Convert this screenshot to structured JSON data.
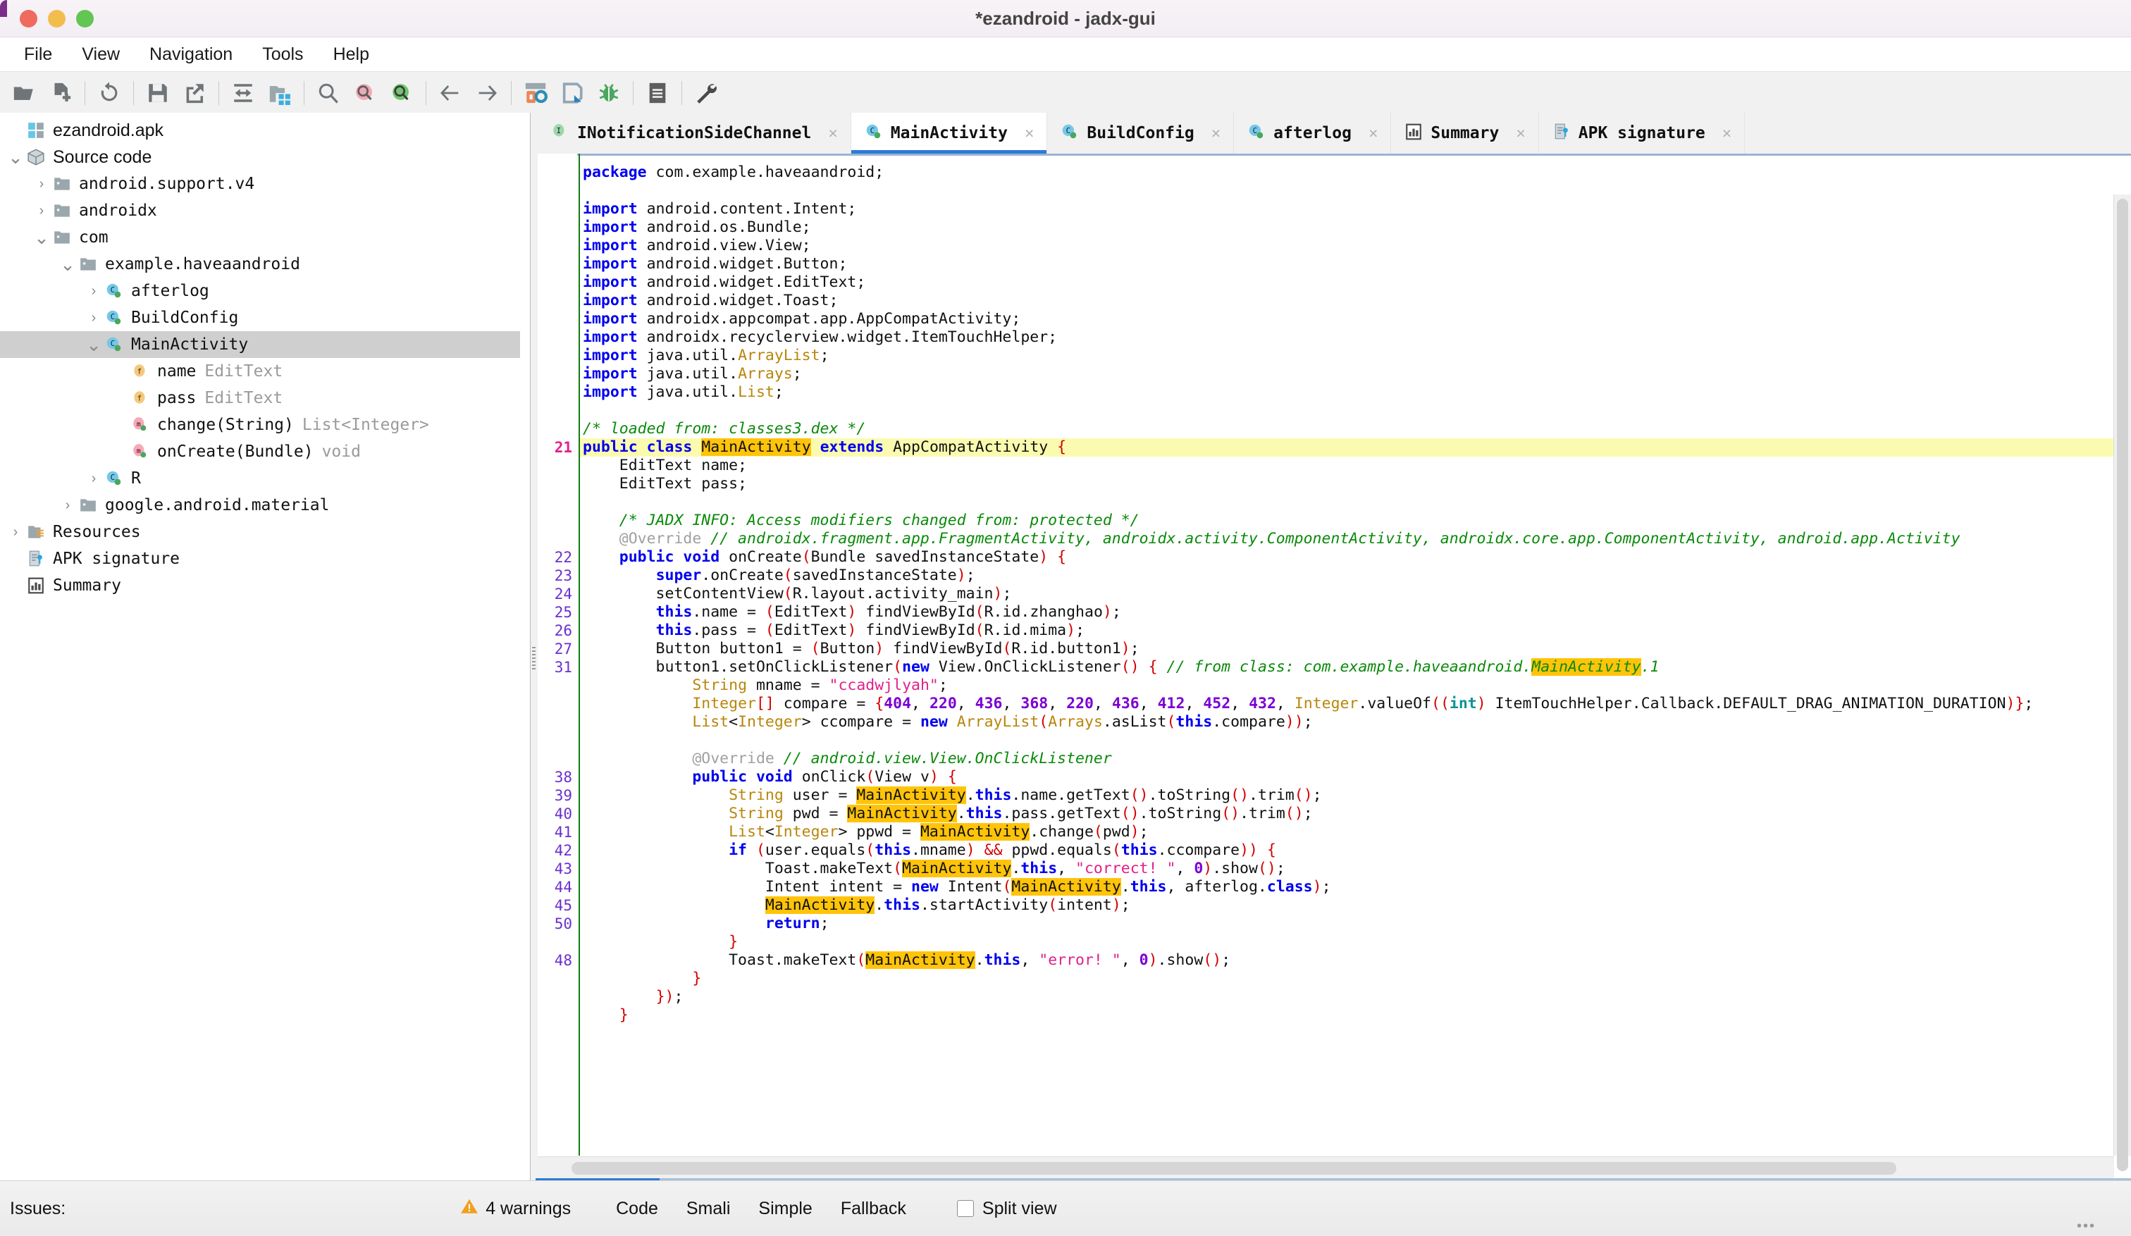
{
  "window": {
    "title": "*ezandroid - jadx-gui",
    "traffic_lights": [
      "close",
      "minimize",
      "maximize"
    ]
  },
  "menu": {
    "items": [
      {
        "label": "File"
      },
      {
        "label": "View"
      },
      {
        "label": "Navigation"
      },
      {
        "label": "Tools"
      },
      {
        "label": "Help"
      }
    ]
  },
  "toolbar": {
    "buttons": [
      {
        "name": "open-file-icon",
        "tip": "Open file"
      },
      {
        "name": "add-files-icon",
        "tip": "Add files"
      },
      {
        "sep": true
      },
      {
        "name": "reload-icon",
        "tip": "Reload"
      },
      {
        "sep": true
      },
      {
        "name": "save-icon",
        "tip": "Save"
      },
      {
        "name": "export-icon",
        "tip": "Export"
      },
      {
        "sep": true
      },
      {
        "name": "sync-icon",
        "tip": "Sync"
      },
      {
        "name": "decompile-all-icon",
        "tip": "Decompile all"
      },
      {
        "sep": true
      },
      {
        "name": "search-icon",
        "tip": "Text search"
      },
      {
        "name": "search-class-icon",
        "tip": "Class search"
      },
      {
        "name": "search-comment-icon",
        "tip": "Comment search"
      },
      {
        "sep": true
      },
      {
        "name": "back-arrow-icon",
        "tip": "Back"
      },
      {
        "name": "forward-arrow-icon",
        "tip": "Forward"
      },
      {
        "sep": true
      },
      {
        "name": "deobfuscation-icon",
        "tip": "Deobfuscation"
      },
      {
        "name": "quark-icon",
        "tip": "Quark engine"
      },
      {
        "name": "debug-icon",
        "tip": "Debugger"
      },
      {
        "sep": true
      },
      {
        "name": "log-icon",
        "tip": "Log viewer"
      },
      {
        "sep": true
      },
      {
        "name": "preferences-icon",
        "tip": "Preferences"
      }
    ]
  },
  "tree": {
    "items": [
      {
        "depth": 0,
        "twist": "",
        "icon": "apk-icon",
        "label": "ezandroid.apk",
        "type": "",
        "selected": false,
        "mono": false
      },
      {
        "depth": 0,
        "twist": "v",
        "icon": "package-icon",
        "label": "Source code",
        "type": "",
        "selected": false,
        "mono": false
      },
      {
        "depth": 1,
        "twist": ">",
        "icon": "folder-icon",
        "label": "android.support.v4",
        "type": "",
        "selected": false,
        "mono": true
      },
      {
        "depth": 1,
        "twist": ">",
        "icon": "folder-icon",
        "label": "androidx",
        "type": "",
        "selected": false,
        "mono": true
      },
      {
        "depth": 1,
        "twist": "v",
        "icon": "folder-icon",
        "label": "com",
        "type": "",
        "selected": false,
        "mono": true
      },
      {
        "depth": 2,
        "twist": "v",
        "icon": "folder-icon",
        "label": "example.haveaandroid",
        "type": "",
        "selected": false,
        "mono": true
      },
      {
        "depth": 3,
        "twist": ">",
        "icon": "class-icon",
        "label": "afterlog",
        "type": "",
        "selected": false,
        "mono": true
      },
      {
        "depth": 3,
        "twist": ">",
        "icon": "class-icon",
        "label": "BuildConfig",
        "type": "",
        "selected": false,
        "mono": true
      },
      {
        "depth": 3,
        "twist": "v",
        "icon": "class-icon",
        "label": "MainActivity",
        "type": "",
        "selected": true,
        "mono": true
      },
      {
        "depth": 4,
        "twist": "",
        "icon": "field-icon",
        "label": "name",
        "type": "EditText",
        "selected": false,
        "mono": true
      },
      {
        "depth": 4,
        "twist": "",
        "icon": "field-icon",
        "label": "pass",
        "type": "EditText",
        "selected": false,
        "mono": true
      },
      {
        "depth": 4,
        "twist": "",
        "icon": "method-icon",
        "label": "change(String)",
        "type": "List<Integer>",
        "selected": false,
        "mono": true
      },
      {
        "depth": 4,
        "twist": "",
        "icon": "method-icon",
        "label": "onCreate(Bundle)",
        "type": "void",
        "selected": false,
        "mono": true
      },
      {
        "depth": 3,
        "twist": ">",
        "icon": "class-icon",
        "label": "R",
        "type": "",
        "selected": false,
        "mono": true
      },
      {
        "depth": 2,
        "twist": ">",
        "icon": "folder-icon",
        "label": "google.android.material",
        "type": "",
        "selected": false,
        "mono": true
      },
      {
        "depth": 0,
        "twist": ">",
        "icon": "resources-icon",
        "label": "Resources",
        "type": "",
        "selected": false,
        "mono": true
      },
      {
        "depth": 0,
        "twist": "",
        "icon": "signature-icon",
        "label": "APK signature",
        "type": "",
        "selected": false,
        "mono": true
      },
      {
        "depth": 0,
        "twist": "",
        "icon": "summary-icon",
        "label": "Summary",
        "type": "",
        "selected": false,
        "mono": true
      }
    ]
  },
  "tabs": [
    {
      "label": "INotificationSideChannel",
      "icon": "interface-icon",
      "active": false,
      "close": "×"
    },
    {
      "label": "MainActivity",
      "icon": "class-icon",
      "active": true,
      "close": "×"
    },
    {
      "label": "BuildConfig",
      "icon": "class-icon",
      "active": false,
      "close": "×"
    },
    {
      "label": "afterlog",
      "icon": "class-icon",
      "active": false,
      "close": "×"
    },
    {
      "label": "Summary",
      "icon": "summary-icon",
      "active": false,
      "close": "×"
    },
    {
      "label": "APK signature",
      "icon": "signature-icon",
      "active": false,
      "close": "×"
    }
  ],
  "editor": {
    "line_numbers": [
      "",
      "",
      "",
      "",
      "",
      "",
      "",
      "",
      "",
      "",
      "",
      "",
      "",
      "",
      "",
      "21",
      "",
      "",
      "",
      "",
      "",
      "22",
      "23",
      "24",
      "25",
      "26",
      "27",
      "31",
      "",
      "",
      "",
      "",
      "",
      "38",
      "39",
      "40",
      "41",
      "42",
      "43",
      "44",
      "45",
      "50",
      "",
      "48",
      "",
      "",
      ""
    ],
    "current_line": "21",
    "highlighted_word": "MainActivity",
    "code_text": "package com.example.haveaandroid;\n\nimport android.content.Intent;\nimport android.os.Bundle;\nimport android.view.View;\nimport android.widget.Button;\nimport android.widget.EditText;\nimport android.widget.Toast;\nimport androidx.appcompat.app.AppCompatActivity;\nimport androidx.recyclerview.widget.ItemTouchHelper;\nimport java.util.ArrayList;\nimport java.util.Arrays;\nimport java.util.List;\n\n/* loaded from: classes3.dex */\npublic class MainActivity extends AppCompatActivity {\n    EditText name;\n    EditText pass;\n\n    /* JADX INFO: Access modifiers changed from: protected */\n    @Override // androidx.fragment.app.FragmentActivity, androidx.activity.ComponentActivity, androidx.core.app.ComponentActivity, android.app.Activity\n    public void onCreate(Bundle savedInstanceState) {\n        super.onCreate(savedInstanceState);\n        setContentView(R.layout.activity_main);\n        this.name = (EditText) findViewById(R.id.zhanghao);\n        this.pass = (EditText) findViewById(R.id.mima);\n        Button button1 = (Button) findViewById(R.id.button1);\n        button1.setOnClickListener(new View.OnClickListener() { // from class: com.example.haveaandroid.MainActivity.1\n            String mname = \"ccadwjlyah\";\n            Integer[] compare = {404, 220, 436, 368, 220, 436, 412, 452, 432, Integer.valueOf((int) ItemTouchHelper.Callback.DEFAULT_DRAG_ANIMATION_DURATION)};\n            List<Integer> ccompare = new ArrayList(Arrays.asList(this.compare));\n\n            @Override // android.view.View.OnClickListener\n            public void onClick(View v) {\n                String user = MainActivity.this.name.getText().toString().trim();\n                String pwd = MainActivity.this.pass.getText().toString().trim();\n                List<Integer> ppwd = MainActivity.change(pwd);\n                if (user.equals(this.mname) && ppwd.equals(this.ccompare)) {\n                    Toast.makeText(MainActivity.this, \"correct! \", 0).show();\n                    Intent intent = new Intent(MainActivity.this, afterlog.class);\n                    MainActivity.this.startActivity(intent);\n                    return;\n                }\n                Toast.makeText(MainActivity.this, \"error! \", 0).show();\n            }\n        });\n    }"
  },
  "statusbar": {
    "issues_label": "Issues:",
    "warnings_text": "4 warnings",
    "warning_icon": "warning-triangle-icon",
    "modes": [
      "Code",
      "Smali",
      "Simple",
      "Fallback"
    ],
    "active_mode": "Code",
    "split_view_label": "Split view",
    "split_view_checked": false
  },
  "colors": {
    "accent": "#2e7bd4",
    "keyword": "#0000ee",
    "string": "#e0218a",
    "comment": "#0a8a0a",
    "number": "#7b00d4",
    "type": "#b8860b",
    "punct": "#d40000",
    "highlight": "#ffc40a",
    "current_line_bg": "#fbfbb0",
    "warning": "#f0a020"
  }
}
